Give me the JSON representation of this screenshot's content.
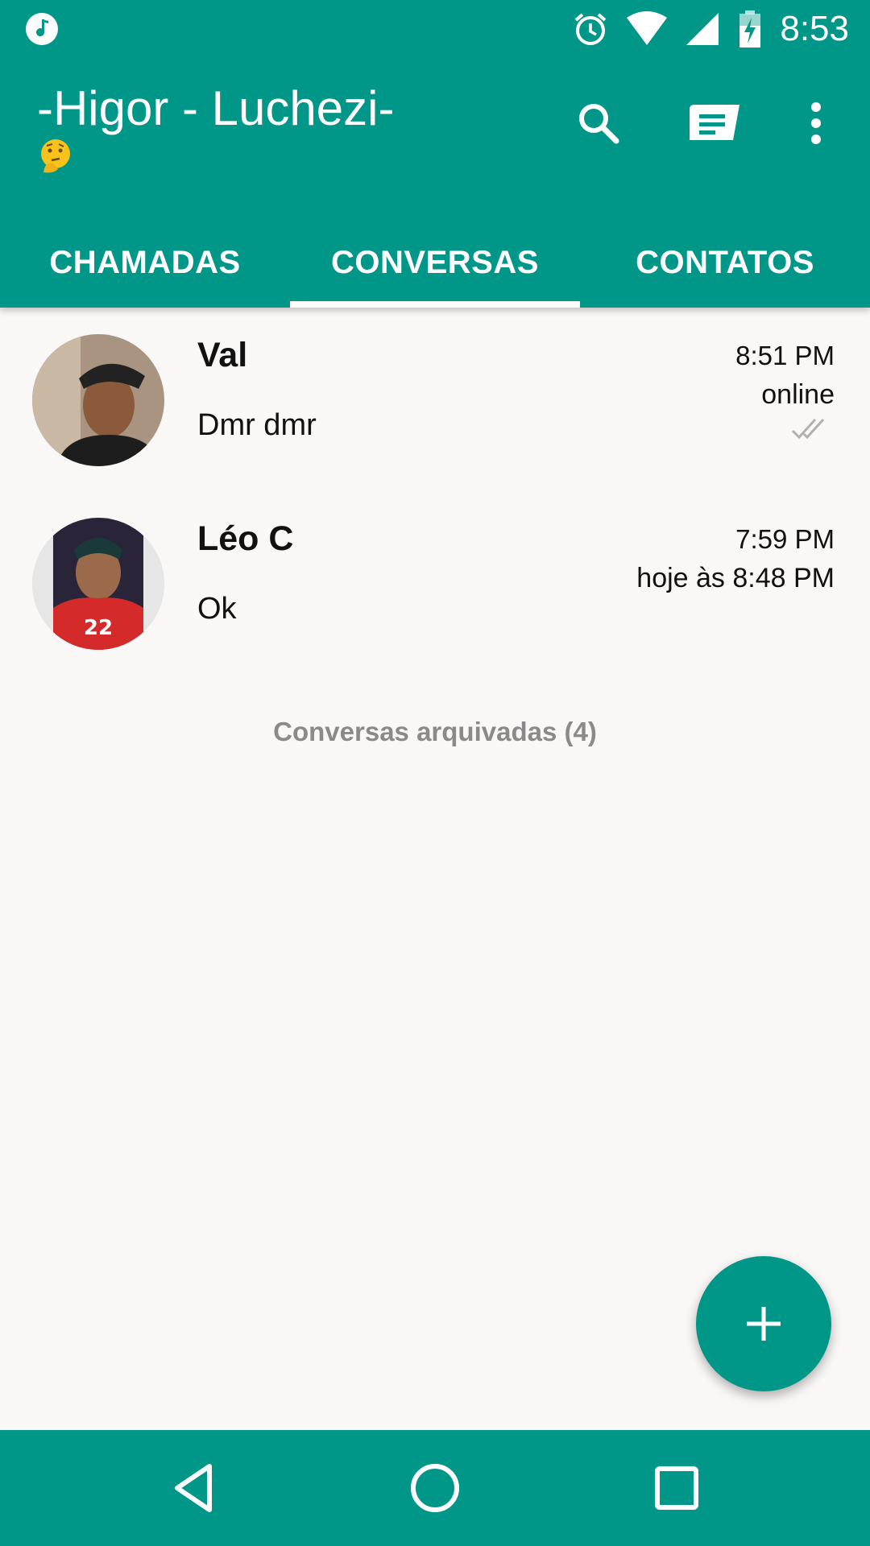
{
  "status_bar": {
    "time": "8:53",
    "icons": [
      "music-note-icon",
      "alarm-icon",
      "wifi-icon",
      "signal-icon",
      "battery-charging-icon"
    ]
  },
  "app_bar": {
    "title": "-Higor - Luchezi-",
    "subtitle_emoji": "thinking-face-emoji",
    "actions": [
      "search-icon",
      "new-chat-icon",
      "more-vert-icon"
    ]
  },
  "tabs": [
    {
      "label": "CHAMADAS",
      "active": false
    },
    {
      "label": "CONVERSAS",
      "active": true
    },
    {
      "label": "CONTATOS",
      "active": false
    }
  ],
  "chats": [
    {
      "name": "Val",
      "message": "Dmr dmr",
      "time": "8:51 PM",
      "status": "online",
      "read_ticks": true
    },
    {
      "name": "Léo C",
      "message": "Ok",
      "time": "7:59 PM",
      "status": "hoje às 8:48 PM",
      "read_ticks": false
    }
  ],
  "archived_label": "Conversas arquivadas (4)",
  "fab_icon": "plus-icon",
  "nav_bar": [
    "back-icon",
    "home-icon",
    "recents-icon"
  ],
  "colors": {
    "primary": "#009688",
    "background": "#faf8f7",
    "archived_text": "#8a8a8a"
  }
}
